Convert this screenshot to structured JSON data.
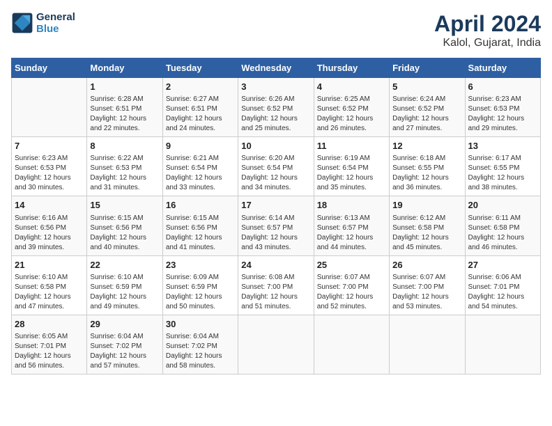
{
  "logo": {
    "line1": "General",
    "line2": "Blue"
  },
  "title": "April 2024",
  "subtitle": "Kalol, Gujarat, India",
  "days_of_week": [
    "Sunday",
    "Monday",
    "Tuesday",
    "Wednesday",
    "Thursday",
    "Friday",
    "Saturday"
  ],
  "weeks": [
    [
      {
        "day": "",
        "info": ""
      },
      {
        "day": "1",
        "info": "Sunrise: 6:28 AM\nSunset: 6:51 PM\nDaylight: 12 hours\nand 22 minutes."
      },
      {
        "day": "2",
        "info": "Sunrise: 6:27 AM\nSunset: 6:51 PM\nDaylight: 12 hours\nand 24 minutes."
      },
      {
        "day": "3",
        "info": "Sunrise: 6:26 AM\nSunset: 6:52 PM\nDaylight: 12 hours\nand 25 minutes."
      },
      {
        "day": "4",
        "info": "Sunrise: 6:25 AM\nSunset: 6:52 PM\nDaylight: 12 hours\nand 26 minutes."
      },
      {
        "day": "5",
        "info": "Sunrise: 6:24 AM\nSunset: 6:52 PM\nDaylight: 12 hours\nand 27 minutes."
      },
      {
        "day": "6",
        "info": "Sunrise: 6:23 AM\nSunset: 6:53 PM\nDaylight: 12 hours\nand 29 minutes."
      }
    ],
    [
      {
        "day": "7",
        "info": "Sunrise: 6:23 AM\nSunset: 6:53 PM\nDaylight: 12 hours\nand 30 minutes."
      },
      {
        "day": "8",
        "info": "Sunrise: 6:22 AM\nSunset: 6:53 PM\nDaylight: 12 hours\nand 31 minutes."
      },
      {
        "day": "9",
        "info": "Sunrise: 6:21 AM\nSunset: 6:54 PM\nDaylight: 12 hours\nand 33 minutes."
      },
      {
        "day": "10",
        "info": "Sunrise: 6:20 AM\nSunset: 6:54 PM\nDaylight: 12 hours\nand 34 minutes."
      },
      {
        "day": "11",
        "info": "Sunrise: 6:19 AM\nSunset: 6:54 PM\nDaylight: 12 hours\nand 35 minutes."
      },
      {
        "day": "12",
        "info": "Sunrise: 6:18 AM\nSunset: 6:55 PM\nDaylight: 12 hours\nand 36 minutes."
      },
      {
        "day": "13",
        "info": "Sunrise: 6:17 AM\nSunset: 6:55 PM\nDaylight: 12 hours\nand 38 minutes."
      }
    ],
    [
      {
        "day": "14",
        "info": "Sunrise: 6:16 AM\nSunset: 6:56 PM\nDaylight: 12 hours\nand 39 minutes."
      },
      {
        "day": "15",
        "info": "Sunrise: 6:15 AM\nSunset: 6:56 PM\nDaylight: 12 hours\nand 40 minutes."
      },
      {
        "day": "16",
        "info": "Sunrise: 6:15 AM\nSunset: 6:56 PM\nDaylight: 12 hours\nand 41 minutes."
      },
      {
        "day": "17",
        "info": "Sunrise: 6:14 AM\nSunset: 6:57 PM\nDaylight: 12 hours\nand 43 minutes."
      },
      {
        "day": "18",
        "info": "Sunrise: 6:13 AM\nSunset: 6:57 PM\nDaylight: 12 hours\nand 44 minutes."
      },
      {
        "day": "19",
        "info": "Sunrise: 6:12 AM\nSunset: 6:58 PM\nDaylight: 12 hours\nand 45 minutes."
      },
      {
        "day": "20",
        "info": "Sunrise: 6:11 AM\nSunset: 6:58 PM\nDaylight: 12 hours\nand 46 minutes."
      }
    ],
    [
      {
        "day": "21",
        "info": "Sunrise: 6:10 AM\nSunset: 6:58 PM\nDaylight: 12 hours\nand 47 minutes."
      },
      {
        "day": "22",
        "info": "Sunrise: 6:10 AM\nSunset: 6:59 PM\nDaylight: 12 hours\nand 49 minutes."
      },
      {
        "day": "23",
        "info": "Sunrise: 6:09 AM\nSunset: 6:59 PM\nDaylight: 12 hours\nand 50 minutes."
      },
      {
        "day": "24",
        "info": "Sunrise: 6:08 AM\nSunset: 7:00 PM\nDaylight: 12 hours\nand 51 minutes."
      },
      {
        "day": "25",
        "info": "Sunrise: 6:07 AM\nSunset: 7:00 PM\nDaylight: 12 hours\nand 52 minutes."
      },
      {
        "day": "26",
        "info": "Sunrise: 6:07 AM\nSunset: 7:00 PM\nDaylight: 12 hours\nand 53 minutes."
      },
      {
        "day": "27",
        "info": "Sunrise: 6:06 AM\nSunset: 7:01 PM\nDaylight: 12 hours\nand 54 minutes."
      }
    ],
    [
      {
        "day": "28",
        "info": "Sunrise: 6:05 AM\nSunset: 7:01 PM\nDaylight: 12 hours\nand 56 minutes."
      },
      {
        "day": "29",
        "info": "Sunrise: 6:04 AM\nSunset: 7:02 PM\nDaylight: 12 hours\nand 57 minutes."
      },
      {
        "day": "30",
        "info": "Sunrise: 6:04 AM\nSunset: 7:02 PM\nDaylight: 12 hours\nand 58 minutes."
      },
      {
        "day": "",
        "info": ""
      },
      {
        "day": "",
        "info": ""
      },
      {
        "day": "",
        "info": ""
      },
      {
        "day": "",
        "info": ""
      }
    ]
  ]
}
